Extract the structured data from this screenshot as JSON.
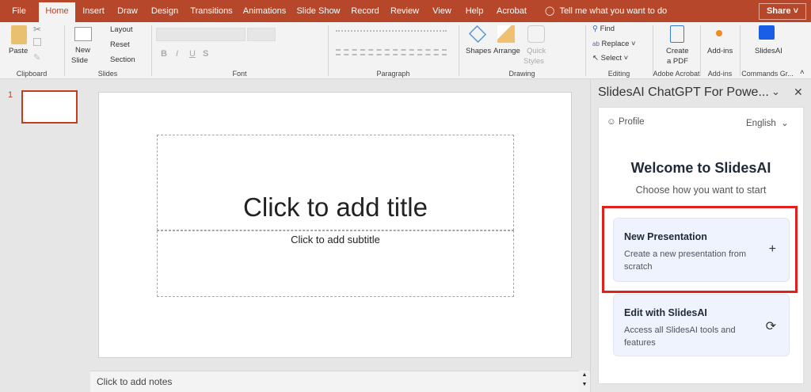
{
  "tabs": [
    "File",
    "Home",
    "Insert",
    "Draw",
    "Design",
    "Transitions",
    "Animations",
    "Slide Show",
    "Record",
    "Review",
    "View",
    "Help",
    "Acrobat"
  ],
  "tell_me": "Tell me what you want to do",
  "share": "Share",
  "ribbon": {
    "clipboard": {
      "paste": "Paste",
      "label": "Clipboard"
    },
    "slides": {
      "new_slide": "New",
      "new_slide2": "Slide",
      "layout": "Layout",
      "reset": "Reset",
      "section": "Section",
      "label": "Slides"
    },
    "font": {
      "label": "Font",
      "bold": "B",
      "italic": "I",
      "underline": "U",
      "strike": "S"
    },
    "paragraph": {
      "label": "Paragraph"
    },
    "drawing": {
      "shapes": "Shapes",
      "arrange": "Arrange",
      "quick": "Quick",
      "styles": "Styles",
      "label": "Drawing"
    },
    "editing": {
      "find": "Find",
      "replace": "Replace",
      "select": "Select",
      "label": "Editing"
    },
    "acrobat": {
      "create": "Create",
      "pdf": "a PDF",
      "label": "Adobe Acrobat"
    },
    "addins": {
      "addins": "Add-ins",
      "label": "Add-ins"
    },
    "commands": {
      "slidesai": "SlidesAI",
      "label": "Commands Gr..."
    }
  },
  "thumbnails": [
    {
      "number": "1"
    }
  ],
  "slide": {
    "title": "Click to add title",
    "subtitle": "Click to add subtitle"
  },
  "notes": "Click to add notes",
  "pane": {
    "title": "SlidesAI ChatGPT For Powe...",
    "profile": "Profile",
    "language": "English",
    "heading": "Welcome to SlidesAI",
    "subheading": "Choose how you want to start",
    "options": [
      {
        "title": "New Presentation",
        "desc": "Create a new presentation from scratch",
        "icon": "plus-icon"
      },
      {
        "title": "Edit with SlidesAI",
        "desc": "Access all SlidesAI tools and features",
        "icon": "refresh-icon"
      }
    ]
  },
  "colors": {
    "brand": "#b7472a",
    "highlight": "#e0201b",
    "card": "#eef3fd"
  }
}
